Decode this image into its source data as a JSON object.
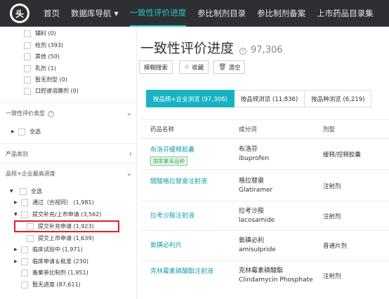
{
  "nav": {
    "logo_text": "头",
    "items": [
      "首页",
      "数据库导航",
      "一致性评价进度",
      "参比制剂目录",
      "参比制剂备案",
      "上市药品目录集"
    ],
    "active_index": 2
  },
  "sidebar": {
    "dosage_items": [
      {
        "label": "辅料 (0)"
      },
      {
        "label": "栓剂 (393)"
      },
      {
        "label": "其他 (50)"
      },
      {
        "label": "乳剂 (1)"
      },
      {
        "label": "暂无剂型 (0)"
      },
      {
        "label": "口腔速溶膜剂 (0)"
      }
    ],
    "section_eval_type": "一致性评价类型",
    "eval_all": "全选",
    "section_category": "产品类别",
    "section_progress": "品规+企业最高进度",
    "progress_all": "全选",
    "progress_items": [
      {
        "label": "通过（合视同） (1,981)"
      },
      {
        "label": "提交补充/上市申请 (3,562)"
      },
      {
        "label": "提交补充申请 (1,923)"
      },
      {
        "label": "提交上市申请 (1,639)"
      },
      {
        "label": "临床试验中 (1,971)"
      },
      {
        "label": "临床申请＆批准 (230)"
      },
      {
        "label": "备案参比制剂 (1,951)"
      },
      {
        "label": "暂无进度 (87,611)"
      }
    ]
  },
  "main": {
    "title": "一致性评价进度",
    "count": "97,306",
    "buttons": {
      "fuzzy": "模糊搜索",
      "favorite": "收藏",
      "clear": "清空"
    },
    "tabs": [
      "按品规+企业浏览 (97,306)",
      "按品规浏览 (11,836)",
      "按品种浏览 (6,219)"
    ],
    "columns": [
      "药品名称",
      "成分词",
      "剂型"
    ],
    "rows": [
      {
        "name": "布洛芬缓释胶囊",
        "tag": "国家集采品种",
        "ingredient_zh": "布洛芬",
        "ingredient_en": "ibuprofen",
        "form": "缓释/控释胶囊"
      },
      {
        "name": "醋酸格拉替雷注射液",
        "tag": "",
        "ingredient_zh": "格拉替雷",
        "ingredient_en": "Glatiramer",
        "form": "注射剂"
      },
      {
        "name": "拉考沙胺注射液",
        "tag": "",
        "ingredient_zh": "拉考沙胺",
        "ingredient_en": "lacosamide",
        "form": "注射剂"
      },
      {
        "name": "氨磺必利片",
        "tag": "",
        "ingredient_zh": "氨磺必利",
        "ingredient_en": "amisulpride",
        "form": "普通片剂"
      },
      {
        "name": "克林霉素磷酸酯注射液",
        "tag": "",
        "ingredient_zh": "克林霉素磷酸酯",
        "ingredient_en": "Clindamycin Phosphate",
        "form": "注射剂"
      }
    ]
  },
  "colors": {
    "nav_bg": "#2d2f33",
    "accent": "#17b3c4",
    "link": "#1a9fb0",
    "highlight": "#e02020",
    "tag_green": "#3aa655"
  }
}
